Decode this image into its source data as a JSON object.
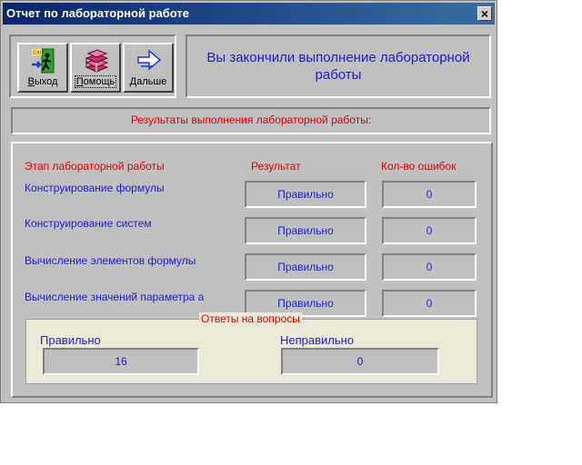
{
  "window": {
    "title": "Отчет по лабораторной работе",
    "close_label": "×"
  },
  "toolbar": {
    "exit": {
      "label_u": "В",
      "label_rest": "ыход",
      "icon": "exit-door-icon"
    },
    "help": {
      "label_u": "П",
      "label_rest": "омощь",
      "icon": "books-icon"
    },
    "next": {
      "label_u": "Д",
      "label_rest": "альше",
      "icon": "right-arrow-icon"
    }
  },
  "message": "Вы закончили выполнение лабораторной работы",
  "results_header": "Результаты выполнения лабораторной работы:",
  "table": {
    "headers": {
      "stage": "Этап лабораторной работы",
      "result": "Результат",
      "errors": "Кол-во ошибок"
    },
    "rows": [
      {
        "stage": "Конструирование формулы",
        "result": "Правильно",
        "errors": "0"
      },
      {
        "stage": "Конструирование систем",
        "result": "Правильно",
        "errors": "0"
      },
      {
        "stage": "Вычисление элементов формулы",
        "result": "Правильно",
        "errors": "0"
      },
      {
        "stage": "Вычисление значений параметра a",
        "result": "Правильно",
        "errors": "0"
      }
    ]
  },
  "answers": {
    "legend": "Ответы на вопросы",
    "correct_label": "Правильно",
    "correct_value": "16",
    "incorrect_label": "Неправильно",
    "incorrect_value": "0"
  },
  "colors": {
    "label_blue": "#1e1ec8",
    "label_red": "#e00000",
    "title_bar": "#0a246a"
  }
}
